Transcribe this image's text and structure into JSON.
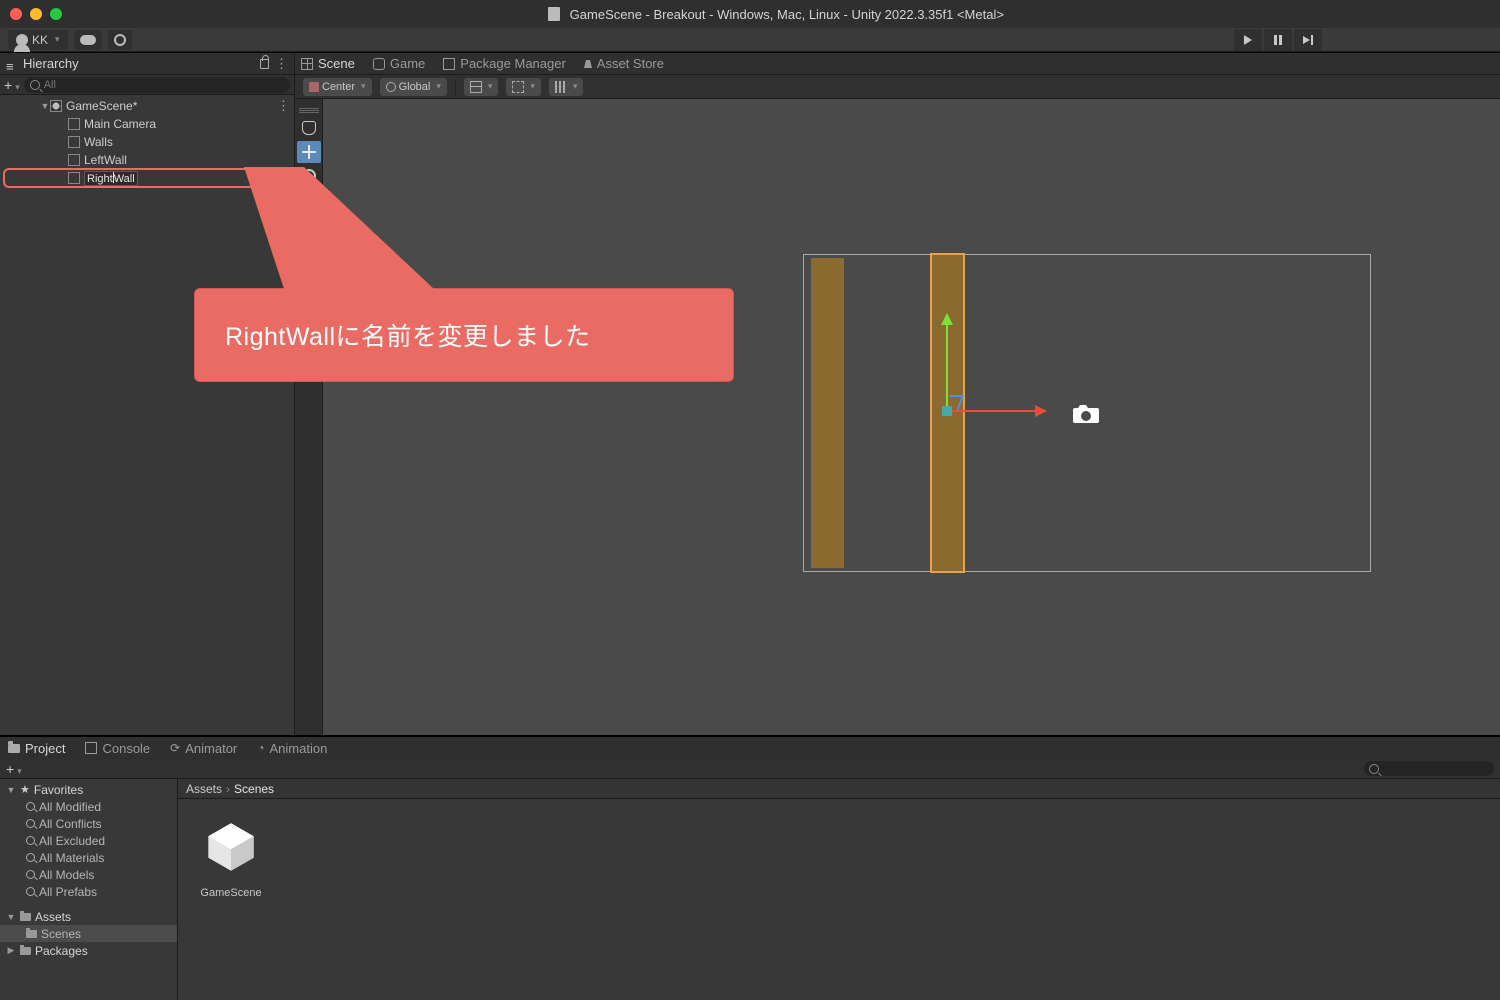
{
  "window": {
    "title": "GameScene - Breakout - Windows, Mac, Linux - Unity 2022.3.35f1 <Metal>"
  },
  "account": {
    "user": "KK"
  },
  "hierarchy": {
    "title": "Hierarchy",
    "search_placeholder": "All",
    "scene": "GameScene*",
    "items": {
      "main_camera": "Main Camera",
      "walls": "Walls",
      "left_wall": "LeftWall",
      "right_wall_before": "Right",
      "right_wall_after": "Wall"
    }
  },
  "scene_tabs": {
    "scene": "Scene",
    "game": "Game",
    "package_manager": "Package Manager",
    "asset_store": "Asset Store"
  },
  "scene_toolbar": {
    "pivot": "Center",
    "space": "Global"
  },
  "callout": {
    "text": "RightWallに名前を変更しました"
  },
  "bottom_tabs": {
    "project": "Project",
    "console": "Console",
    "animator": "Animator",
    "animation": "Animation"
  },
  "project_tree": {
    "favorites": "Favorites",
    "fav_items": {
      "all_modified": "All Modified",
      "all_conflicts": "All Conflicts",
      "all_excluded": "All Excluded",
      "all_materials": "All Materials",
      "all_models": "All Models",
      "all_prefabs": "All Prefabs"
    },
    "assets": "Assets",
    "scenes": "Scenes",
    "packages": "Packages"
  },
  "breadcrumbs": {
    "a": "Assets",
    "b": "Scenes"
  },
  "assets_grid": {
    "item1": "GameScene"
  }
}
